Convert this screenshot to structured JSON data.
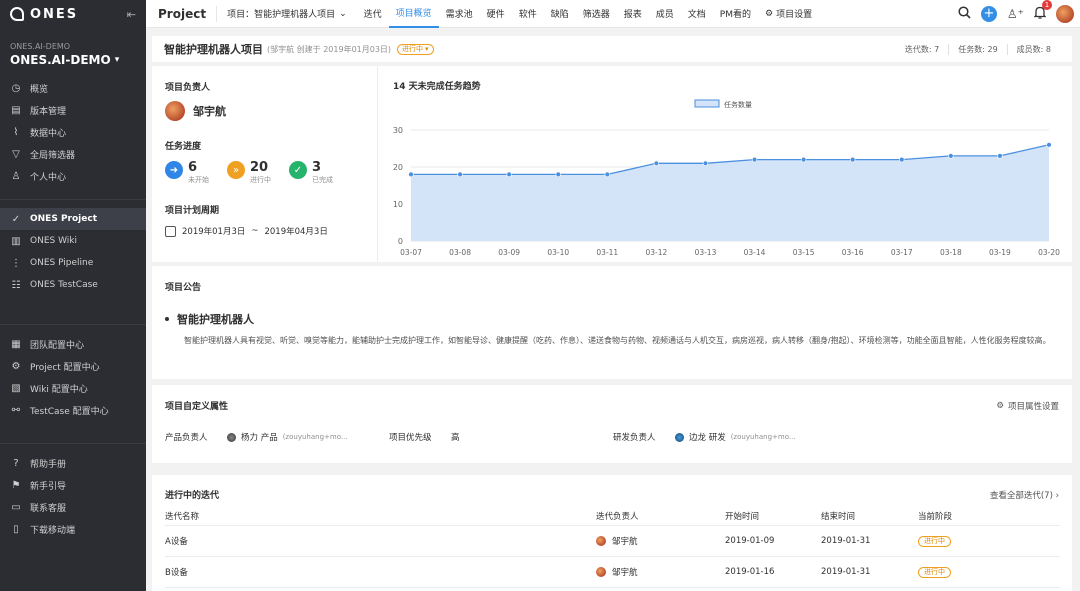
{
  "app": {
    "logo_text": "ONES"
  },
  "org": {
    "label": "ONES.AI-DEMO",
    "name": "ONES.AI-DEMO"
  },
  "sidebar": {
    "top": [
      {
        "label": "概览",
        "icon": "dashboard-icon"
      },
      {
        "label": "版本管理",
        "icon": "version-icon"
      },
      {
        "label": "数据中心",
        "icon": "chart-icon"
      },
      {
        "label": "全局筛选器",
        "icon": "filter-icon"
      },
      {
        "label": "个人中心",
        "icon": "user-icon"
      }
    ],
    "products": [
      {
        "label": "ONES Project",
        "icon": "check-circle-icon",
        "active": true
      },
      {
        "label": "ONES Wiki",
        "icon": "book-icon"
      },
      {
        "label": "ONES Pipeline",
        "icon": "pipeline-icon"
      },
      {
        "label": "ONES TestCase",
        "icon": "testcase-icon"
      }
    ],
    "config": [
      {
        "label": "团队配置中心",
        "icon": "team-icon"
      },
      {
        "label": "Project 配置中心",
        "icon": "settings-icon"
      },
      {
        "label": "Wiki 配置中心",
        "icon": "wiki-config-icon"
      },
      {
        "label": "TestCase 配置中心",
        "icon": "testcase-config-icon"
      }
    ],
    "help": [
      {
        "label": "帮助手册",
        "icon": "help-icon"
      },
      {
        "label": "新手引导",
        "icon": "guide-icon"
      },
      {
        "label": "联系客服",
        "icon": "chat-icon"
      },
      {
        "label": "下载移动端",
        "icon": "mobile-icon"
      }
    ]
  },
  "topbar": {
    "module": "Project",
    "breadcrumb": "项目：智能护理机器人项目",
    "tabs": [
      "迭代",
      "项目概览",
      "需求池",
      "硬件",
      "软件",
      "缺陷",
      "筛选器",
      "报表",
      "成员",
      "文档",
      "PM看的",
      "项目设置"
    ],
    "active_tab": "项目概览",
    "notifications": "1"
  },
  "project": {
    "title": "智能护理机器人项目",
    "meta": "(邹宇航 创建于 2019年01月03日)",
    "status": "进行中",
    "stats": {
      "iterations": "迭代数: 7",
      "tasks": "任务数: 29",
      "members": "成员数: 8"
    }
  },
  "overview": {
    "owner_title": "项目负责人",
    "owner_name": "邹宇航",
    "progress_title": "任务进度",
    "progress": [
      {
        "count": "6",
        "label": "未开始",
        "color": "#2f86e6",
        "icon": "arrow-right-icon"
      },
      {
        "count": "20",
        "label": "进行中",
        "color": "#f0a020",
        "icon": "double-arrow-icon"
      },
      {
        "count": "3",
        "label": "已完成",
        "color": "#26b36b",
        "icon": "check-icon"
      }
    ],
    "period_title": "项目计划周期",
    "period_start": "2019年01月3日",
    "period_sep": "~",
    "period_end": "2019年04月3日"
  },
  "chart_data": {
    "type": "area",
    "title": "14 天未完成任务趋势",
    "x": [
      "03-07",
      "03-08",
      "03-09",
      "03-10",
      "03-11",
      "03-12",
      "03-13",
      "03-14",
      "03-15",
      "03-16",
      "03-17",
      "03-18",
      "03-19",
      "03-20"
    ],
    "series": [
      {
        "name": "任务数量",
        "values": [
          18,
          18,
          18,
          18,
          18,
          21,
          21,
          22,
          22,
          22,
          22,
          23,
          23,
          26
        ]
      }
    ],
    "yticks": [
      0,
      10,
      20,
      30
    ],
    "ylim": [
      0,
      30
    ],
    "legend": "top-center",
    "color": "#4a8fe0",
    "fill": "#d3e4f9"
  },
  "notice": {
    "title": "项目公告",
    "heading": "智能护理机器人",
    "body": "智能护理机器人具有视觉、听觉、嗅觉等能力，能辅助护士完成护理工作，如智能导诊、健康提醒（吃药、作息）、递送食物与药物、视频通话与人机交互，病房巡视，病人转移（翻身/抱起）、环境检测等，功能全面且智能，人性化服务程度较高。"
  },
  "attrs": {
    "title": "项目自定义属性",
    "settings_link": "项目属性设置",
    "product_owner_key": "产品负责人",
    "product_owner_name": "杨力 产品",
    "product_owner_sub": "(zouyuhang+mo...",
    "priority_key": "项目优先级",
    "priority_value": "高",
    "dev_owner_key": "研发负责人",
    "dev_owner_name": "边龙 研发",
    "dev_owner_sub": "(zouyuhang+mo..."
  },
  "iterations": {
    "title": "进行中的迭代",
    "view_all": "查看全部迭代(7)",
    "columns": [
      "迭代名称",
      "迭代负责人",
      "开始时间",
      "结束时间",
      "当前阶段"
    ],
    "rows": [
      {
        "name": "A设备",
        "owner": "邹宇航",
        "start": "2019-01-09",
        "end": "2019-01-31",
        "stage": "进行中"
      },
      {
        "name": "B设备",
        "owner": "邹宇航",
        "start": "2019-01-16",
        "end": "2019-01-31",
        "stage": "进行中"
      }
    ]
  }
}
